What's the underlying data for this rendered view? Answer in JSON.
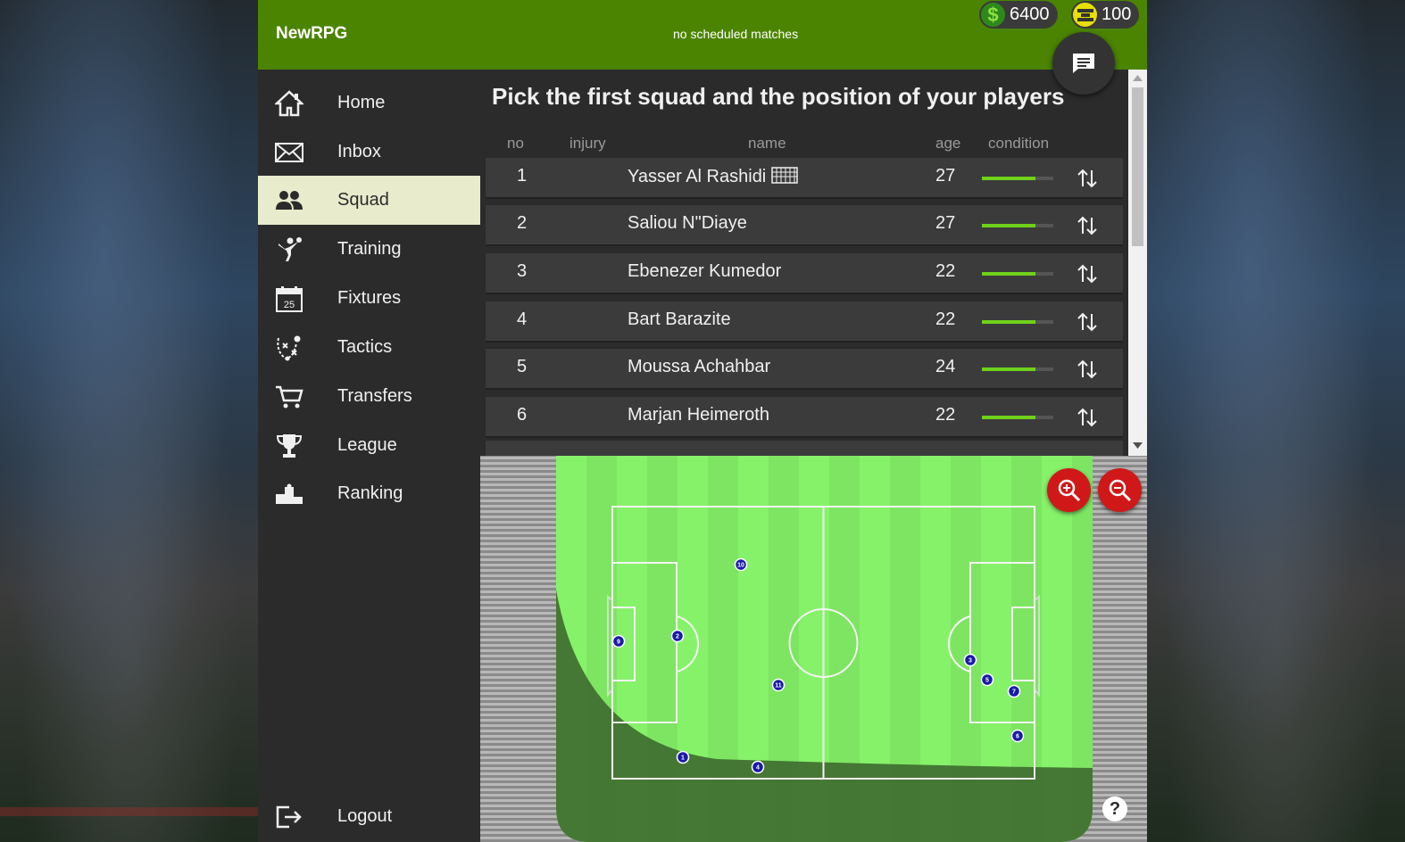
{
  "header": {
    "brand": "NewRPG",
    "status": "no scheduled matches",
    "money": "6400",
    "money_icon": "dollar-icon",
    "tokens": "100",
    "tokens_icon": "token-icon",
    "chat_icon": "chat-icon"
  },
  "colors": {
    "topbar": "#4b8400",
    "active_nav": "#e8ebcc",
    "condition": "#6fd11a",
    "zoom": "#d01818",
    "player": "#1a1aa8"
  },
  "nav": [
    {
      "label": "Home",
      "icon": "home-icon"
    },
    {
      "label": "Inbox",
      "icon": "envelope-icon"
    },
    {
      "label": "Squad",
      "icon": "users-icon",
      "active": true
    },
    {
      "label": "Training",
      "icon": "training-icon"
    },
    {
      "label": "Fixtures",
      "icon": "calendar-icon",
      "icon_text": "25"
    },
    {
      "label": "Tactics",
      "icon": "tactics-icon"
    },
    {
      "label": "Transfers",
      "icon": "cart-icon"
    },
    {
      "label": "League",
      "icon": "trophy-icon"
    },
    {
      "label": "Ranking",
      "icon": "podium-icon"
    }
  ],
  "logout": {
    "label": "Logout",
    "icon": "logout-icon"
  },
  "squad": {
    "title": "Pick the first squad and the position of your players",
    "columns": {
      "no": "no",
      "injury": "injury",
      "name": "name",
      "age": "age",
      "condition": "condition"
    },
    "rows": [
      {
        "no": "1",
        "name": "Yasser Al Rashidi",
        "age": "27",
        "condition": 0.75,
        "goalkeeper": true
      },
      {
        "no": "2",
        "name": "Saliou N\"Diaye",
        "age": "27",
        "condition": 0.75
      },
      {
        "no": "3",
        "name": "Ebenezer Kumedor",
        "age": "22",
        "condition": 0.75
      },
      {
        "no": "4",
        "name": "Bart Barazite",
        "age": "22",
        "condition": 0.75
      },
      {
        "no": "5",
        "name": "Moussa Achahbar",
        "age": "24",
        "condition": 0.75
      },
      {
        "no": "6",
        "name": "Marjan Heimeroth",
        "age": "22",
        "condition": 0.75
      }
    ]
  },
  "pitch": {
    "players": [
      "1",
      "2",
      "3",
      "4",
      "5",
      "6",
      "7",
      "9",
      "10",
      "11"
    ],
    "zoom_in_icon": "zoom-in-icon",
    "zoom_out_icon": "zoom-out-icon",
    "help": "?"
  }
}
